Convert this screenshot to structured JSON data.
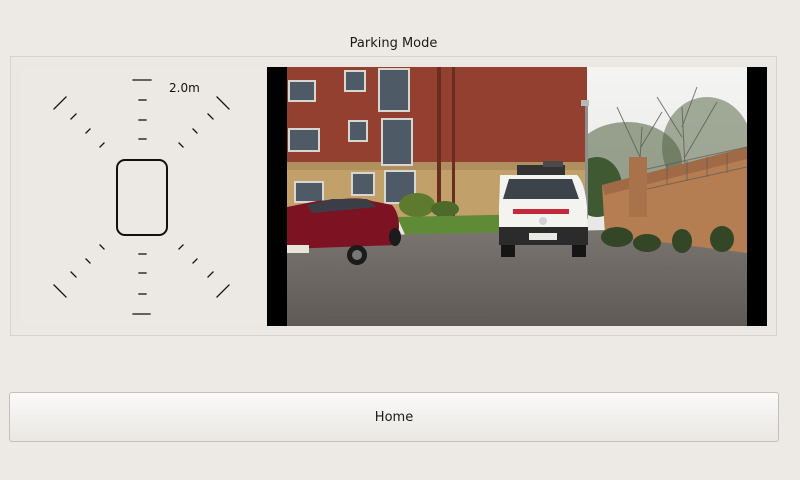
{
  "header": {
    "title": "Parking Mode"
  },
  "sensor": {
    "scale_label": "2.0m"
  },
  "camera": {
    "icon": "rear-camera-feed"
  },
  "footer": {
    "home_label": "Home"
  }
}
